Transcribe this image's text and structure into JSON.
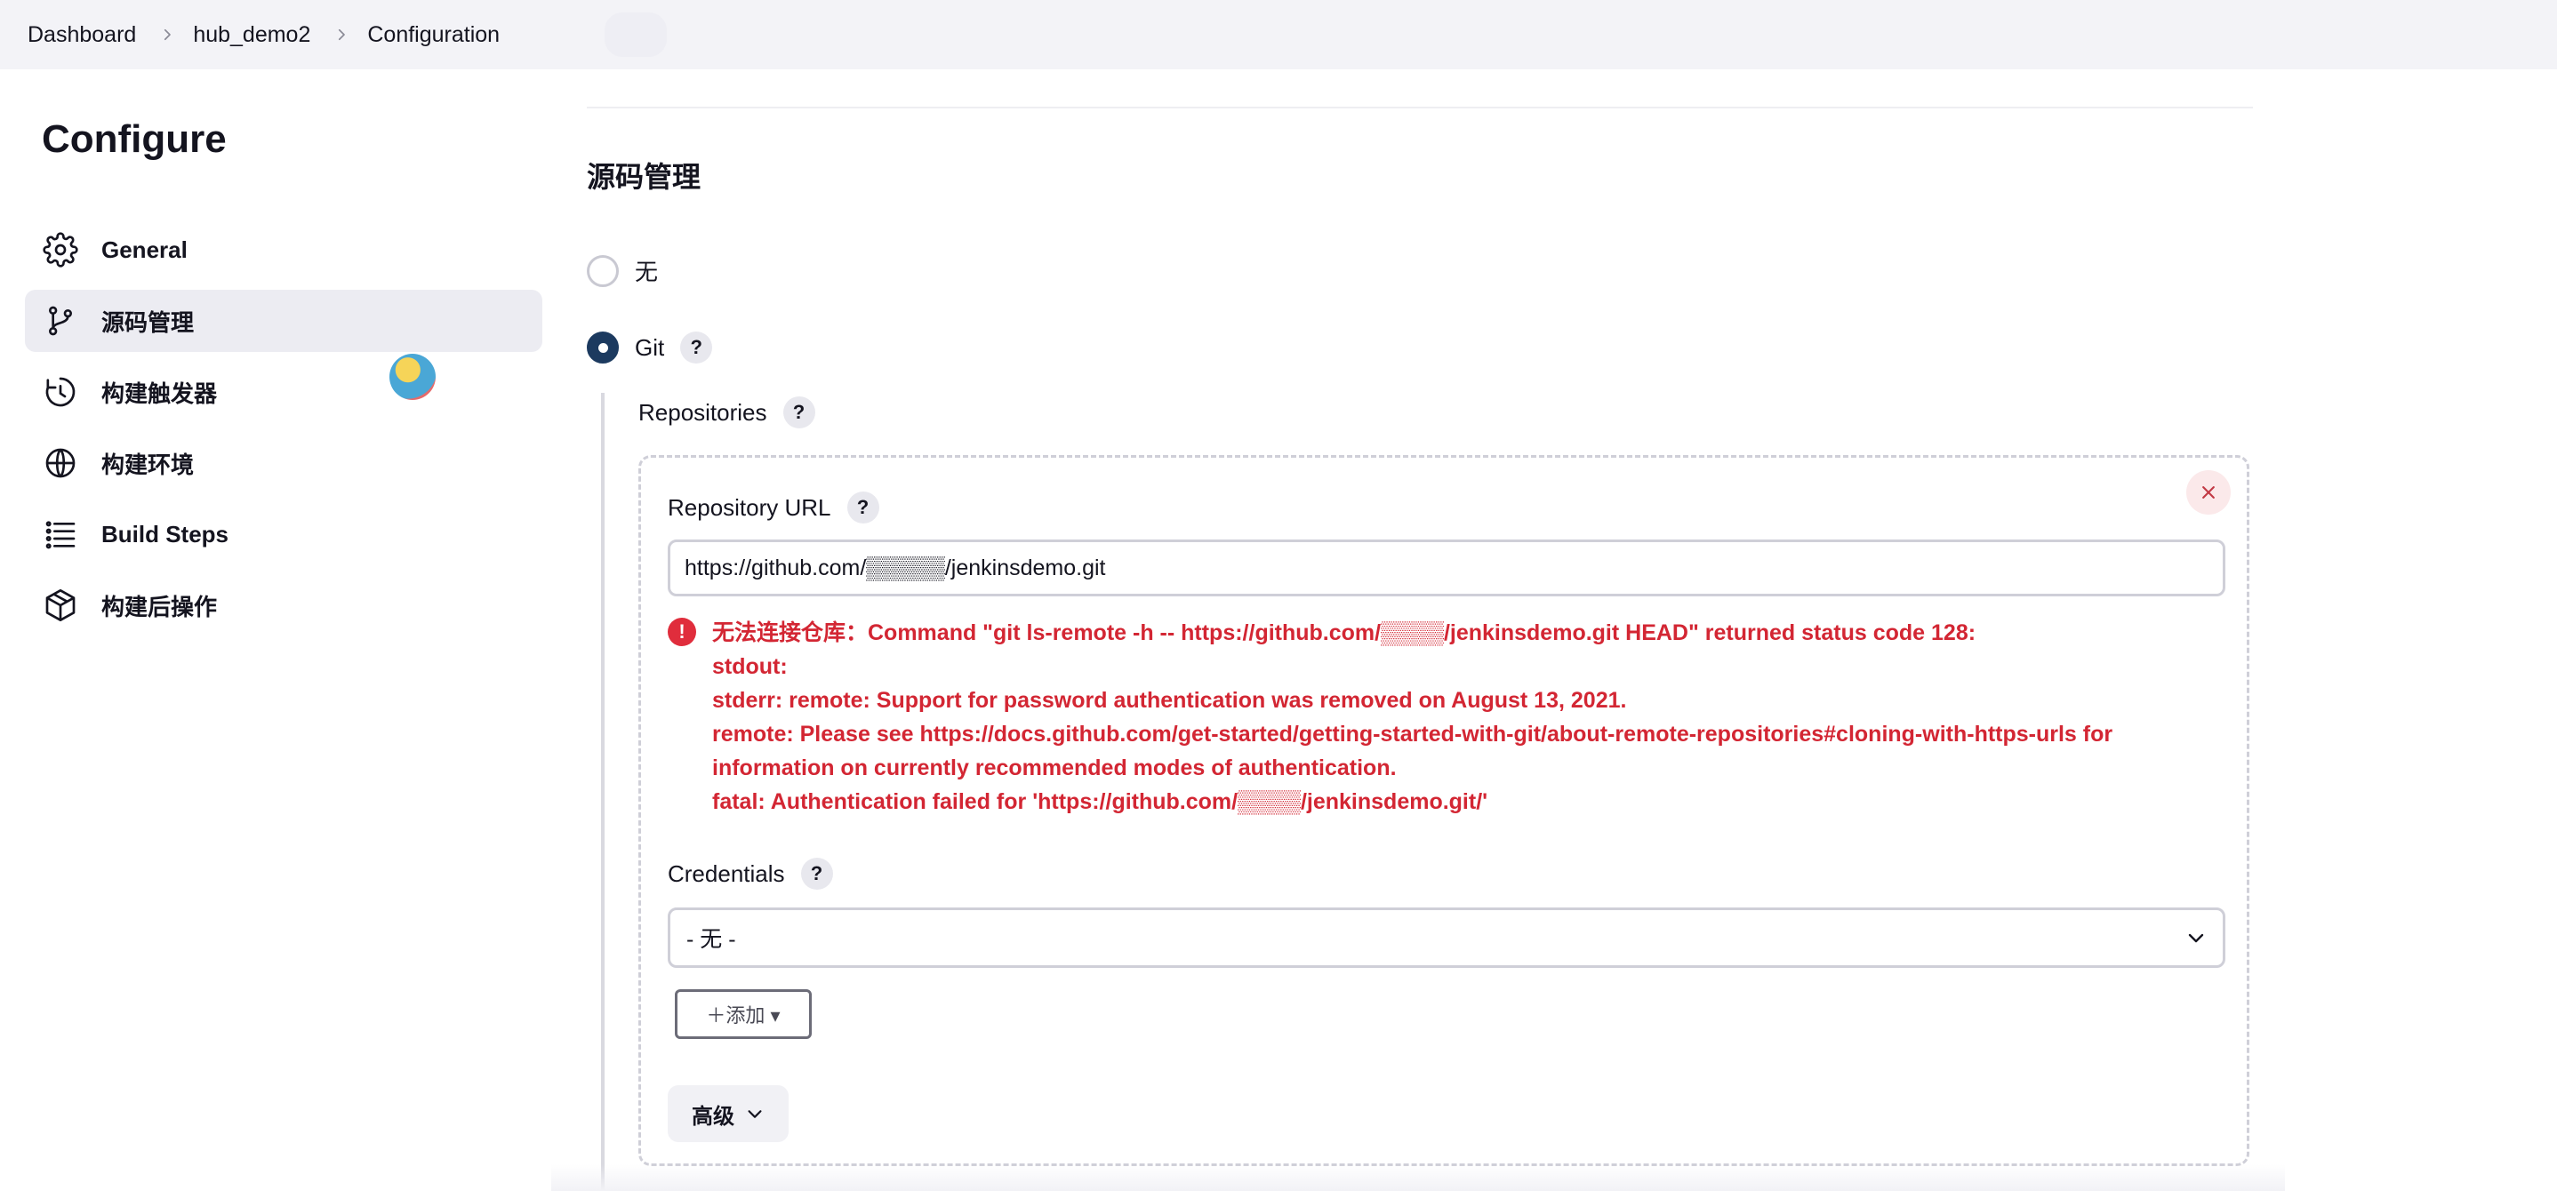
{
  "breadcrumb": {
    "items": [
      "Dashboard",
      "hub_demo2",
      "Configuration"
    ]
  },
  "sidebar": {
    "title": "Configure",
    "items": [
      {
        "label": "General",
        "icon": "gear-icon"
      },
      {
        "label": "源码管理",
        "icon": "git-branch-icon",
        "active": true
      },
      {
        "label": "构建触发器",
        "icon": "clock-icon"
      },
      {
        "label": "构建环境",
        "icon": "globe-icon"
      },
      {
        "label": "Build Steps",
        "icon": "list-icon"
      },
      {
        "label": "构建后操作",
        "icon": "package-icon"
      }
    ]
  },
  "scm": {
    "section_title": "源码管理",
    "options": [
      {
        "label": "无",
        "selected": false
      },
      {
        "label": "Git",
        "selected": true
      }
    ],
    "help_label": "?",
    "repositories_label": "Repositories",
    "repository": {
      "url_label": "Repository URL",
      "url_value": "https://github.com/▒▒▒▒▒/jenkinsdemo.git",
      "error_lines": [
        "无法连接仓库：Command \"git ls-remote -h -- https://github.com/▒▒▒▒/jenkinsdemo.git HEAD\" returned status code 128:",
        "stdout:",
        "stderr: remote: Support for password authentication was removed on August 13, 2021.",
        "remote: Please see https://docs.github.com/get-started/getting-started-with-git/about-remote-repositories#cloning-with-https-urls for information on currently recommended modes of authentication.",
        "fatal: Authentication failed for 'https://github.com/▒▒▒▒/jenkinsdemo.git/'"
      ],
      "credentials_label": "Credentials",
      "credentials_value": "- 无 -",
      "add_button": "＋添加 ▾",
      "advanced_button": "高级"
    }
  },
  "colors": {
    "error": "#d32633",
    "radio_selected": "#1c3a5f",
    "active_nav_bg": "#ececf2"
  }
}
